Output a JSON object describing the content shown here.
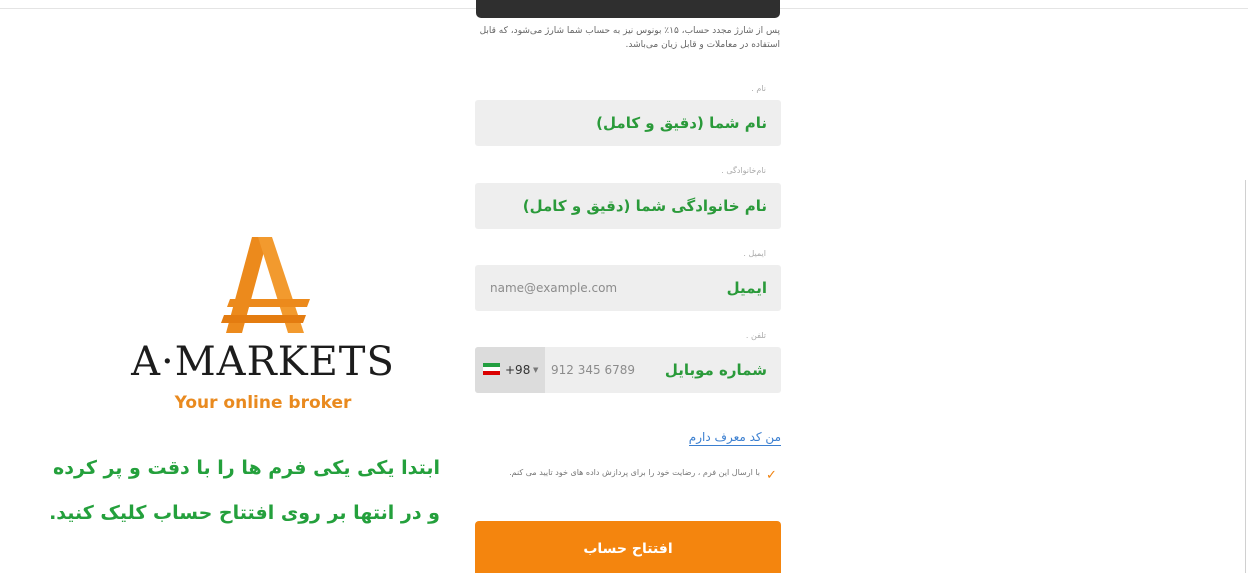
{
  "form": {
    "bonus_note": "پس از شارژ مجدد حساب، ۱۵٪ بونوس نیز به حساب شما شارژ می‌شود، که قابل استفاده در معاملات و قابل زیان می‌باشد.",
    "first_name": {
      "label": "نام .",
      "placeholder": "نام شما (دقیق و کامل)"
    },
    "last_name": {
      "label": "نام‌خانوادگی .",
      "placeholder": "نام خانوادگی شما (دقیق و کامل)"
    },
    "email": {
      "label": "ایمیل .",
      "placeholder": "ایمیل",
      "example": "name@example.com"
    },
    "phone": {
      "label": "تلفن .",
      "placeholder": "شماره موبایل",
      "country_code": "+98",
      "example": "912 345 6789"
    },
    "referral_link": "من کد معرف دارم",
    "consent_text": "با ارسال این فرم ، رضایت خود را برای پردازش داده های خود تایید می کنم.",
    "submit_label": "افتتاح حساب"
  },
  "brand": {
    "name": "A·MARKETS",
    "tagline": "Your online broker",
    "accent_color": "#f4850e"
  },
  "instruction": {
    "line1": "ابتدا یکی یکی فرم ها را با دقت و پر کرده",
    "line2": "و در انتها بر روی افتتاح حساب کلیک کنید."
  },
  "colors": {
    "green": "#24a03c",
    "link": "#3b7fd0"
  },
  "icons": {
    "flag": "iran-flag-icon",
    "caret": "caret-down-icon",
    "check": "check-icon"
  }
}
